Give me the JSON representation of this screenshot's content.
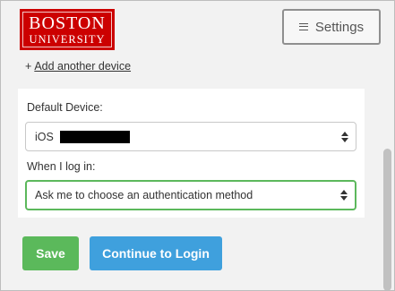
{
  "logo": {
    "line1": "BOSTON",
    "line2": "UNIVERSITY",
    "color": "#cc0000"
  },
  "header": {
    "settings_label": "Settings",
    "settings_icon": "menu-icon"
  },
  "add_device": {
    "prefix": "+",
    "link_label": "Add another device"
  },
  "form": {
    "default_device_label": "Default Device:",
    "default_device_value": "iOS",
    "login_label": "When I log in:",
    "login_value": "Ask me to choose an authentication method"
  },
  "actions": {
    "save_label": "Save",
    "continue_label": "Continue to Login"
  },
  "colors": {
    "save": "#5bb95b",
    "continue": "#3fa0dd",
    "select_focus": "#5cb85c"
  }
}
